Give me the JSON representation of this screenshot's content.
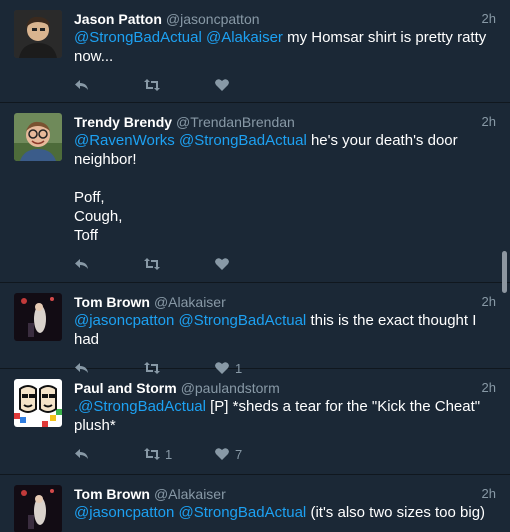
{
  "tweets": [
    {
      "name": "Jason Patton",
      "handle": "@jasoncpatton",
      "time": "2h",
      "mentions": [
        "@StrongBadActual",
        "@Alakaiser"
      ],
      "text": " my Homsar shirt is pretty ratty now...",
      "retweets": "",
      "likes": "",
      "avatar": "person-dark-hair-icon"
    },
    {
      "name": "Trendy Brendy",
      "handle": "@TrendanBrendan",
      "time": "2h",
      "mentions": [
        "@RavenWorks",
        "@StrongBadActual"
      ],
      "text": " he's your death's door neighbor!\n\nPoff,\nCough,\nToff",
      "retweets": "",
      "likes": "",
      "avatar": "person-glasses-icon"
    },
    {
      "name": "Tom Brown",
      "handle": "@Alakaiser",
      "time": "2h",
      "mentions": [
        "@jasoncpatton",
        "@StrongBadActual"
      ],
      "text": " this is the exact thought I had",
      "retweets": "",
      "likes": "1",
      "avatar": "stage-performer-icon"
    },
    {
      "name": "Paul and Storm",
      "handle": "@paulandstorm",
      "time": "2h",
      "mentions": [
        ".@StrongBadActual"
      ],
      "text": " [P] *sheds a tear for the \"Kick the Cheat\" plush*",
      "retweets": "1",
      "likes": "7",
      "avatar": "two-cartoon-faces-icon"
    },
    {
      "name": "Tom Brown",
      "handle": "@Alakaiser",
      "time": "2h",
      "mentions": [
        "@jasoncpatton",
        "@StrongBadActual"
      ],
      "text": " (it's also two sizes too big)",
      "retweets": "",
      "likes": "",
      "avatar": "stage-performer-icon"
    }
  ],
  "colors": {
    "background": "#1b2836",
    "mention": "#1da1f2",
    "muted": "#8899a6",
    "divider": "#10171e"
  },
  "icons": [
    "reply-icon",
    "retweet-icon",
    "like-icon"
  ]
}
